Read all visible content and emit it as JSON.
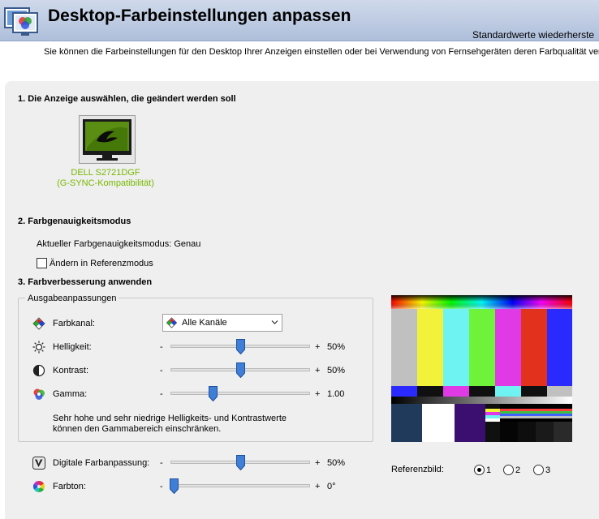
{
  "header": {
    "title": "Desktop-Farbeinstellungen anpassen",
    "restore_link": "Standardwerte wiederherste",
    "description": "Sie können die Farbeinstellungen für den Desktop Ihrer Anzeigen einstellen oder bei Verwendung von Fernsehgeräten deren Farbqualität verbess"
  },
  "section1": {
    "title": "1. Die Anzeige auswählen, die geändert werden soll",
    "display_name": "DELL S2721DGF",
    "display_sub": "(G-SYNC-Kompatibilität)"
  },
  "section2": {
    "title": "2. Farbgenauigkeitsmodus",
    "current_mode": "Aktueller Farbgenauigkeitsmodus: Genau",
    "reference_checkbox_label": "Ändern in Referenzmodus",
    "reference_checked": false
  },
  "section3": {
    "title": "3. Farbverbesserung anwenden",
    "group_label": "Ausgabeanpassungen",
    "channel": {
      "label": "Farbkanal:",
      "selected": "Alle Kanäle"
    },
    "sliders": [
      {
        "id": "brightness",
        "label": "Helligkeit:",
        "minus": "-",
        "plus": "+",
        "value": "50%",
        "fraction": 0.5
      },
      {
        "id": "contrast",
        "label": "Kontrast:",
        "minus": "-",
        "plus": "+",
        "value": "50%",
        "fraction": 0.5
      },
      {
        "id": "gamma",
        "label": "Gamma:",
        "minus": "-",
        "plus": "+",
        "value": "1.00",
        "fraction": 0.29
      }
    ],
    "note_line1": "Sehr hohe und sehr niedrige Helligkeits- und Kontrastwerte",
    "note_line2": "können den Gammabereich einschränken.",
    "digital_vibrance": {
      "label": "Digitale Farbanpassung:",
      "minus": "-",
      "plus": "+",
      "value": "50%",
      "fraction": 0.5
    },
    "hue": {
      "label": "Farbton:",
      "minus": "-",
      "plus": "+",
      "value": "0°",
      "fraction": 0.0
    }
  },
  "reference_image": {
    "label": "Referenzbild:",
    "options": [
      "1",
      "2",
      "3"
    ],
    "selected": "1"
  },
  "colors": {
    "header_gradient_top": "#cfd9ea",
    "header_gradient_bottom": "#aebfdb",
    "panel": "#efefef",
    "nvidia_green": "#76b900",
    "slider_thumb": "#3f7fd8"
  },
  "icons": {
    "header": "nvidia-display-color-icon",
    "channel": "rgb-diamond-icon",
    "brightness": "sun-icon",
    "contrast": "half-circle-icon",
    "gamma": "rgb-circles-icon",
    "digital_vibrance": "vibrance-v-icon",
    "hue": "color-wheel-icon"
  }
}
